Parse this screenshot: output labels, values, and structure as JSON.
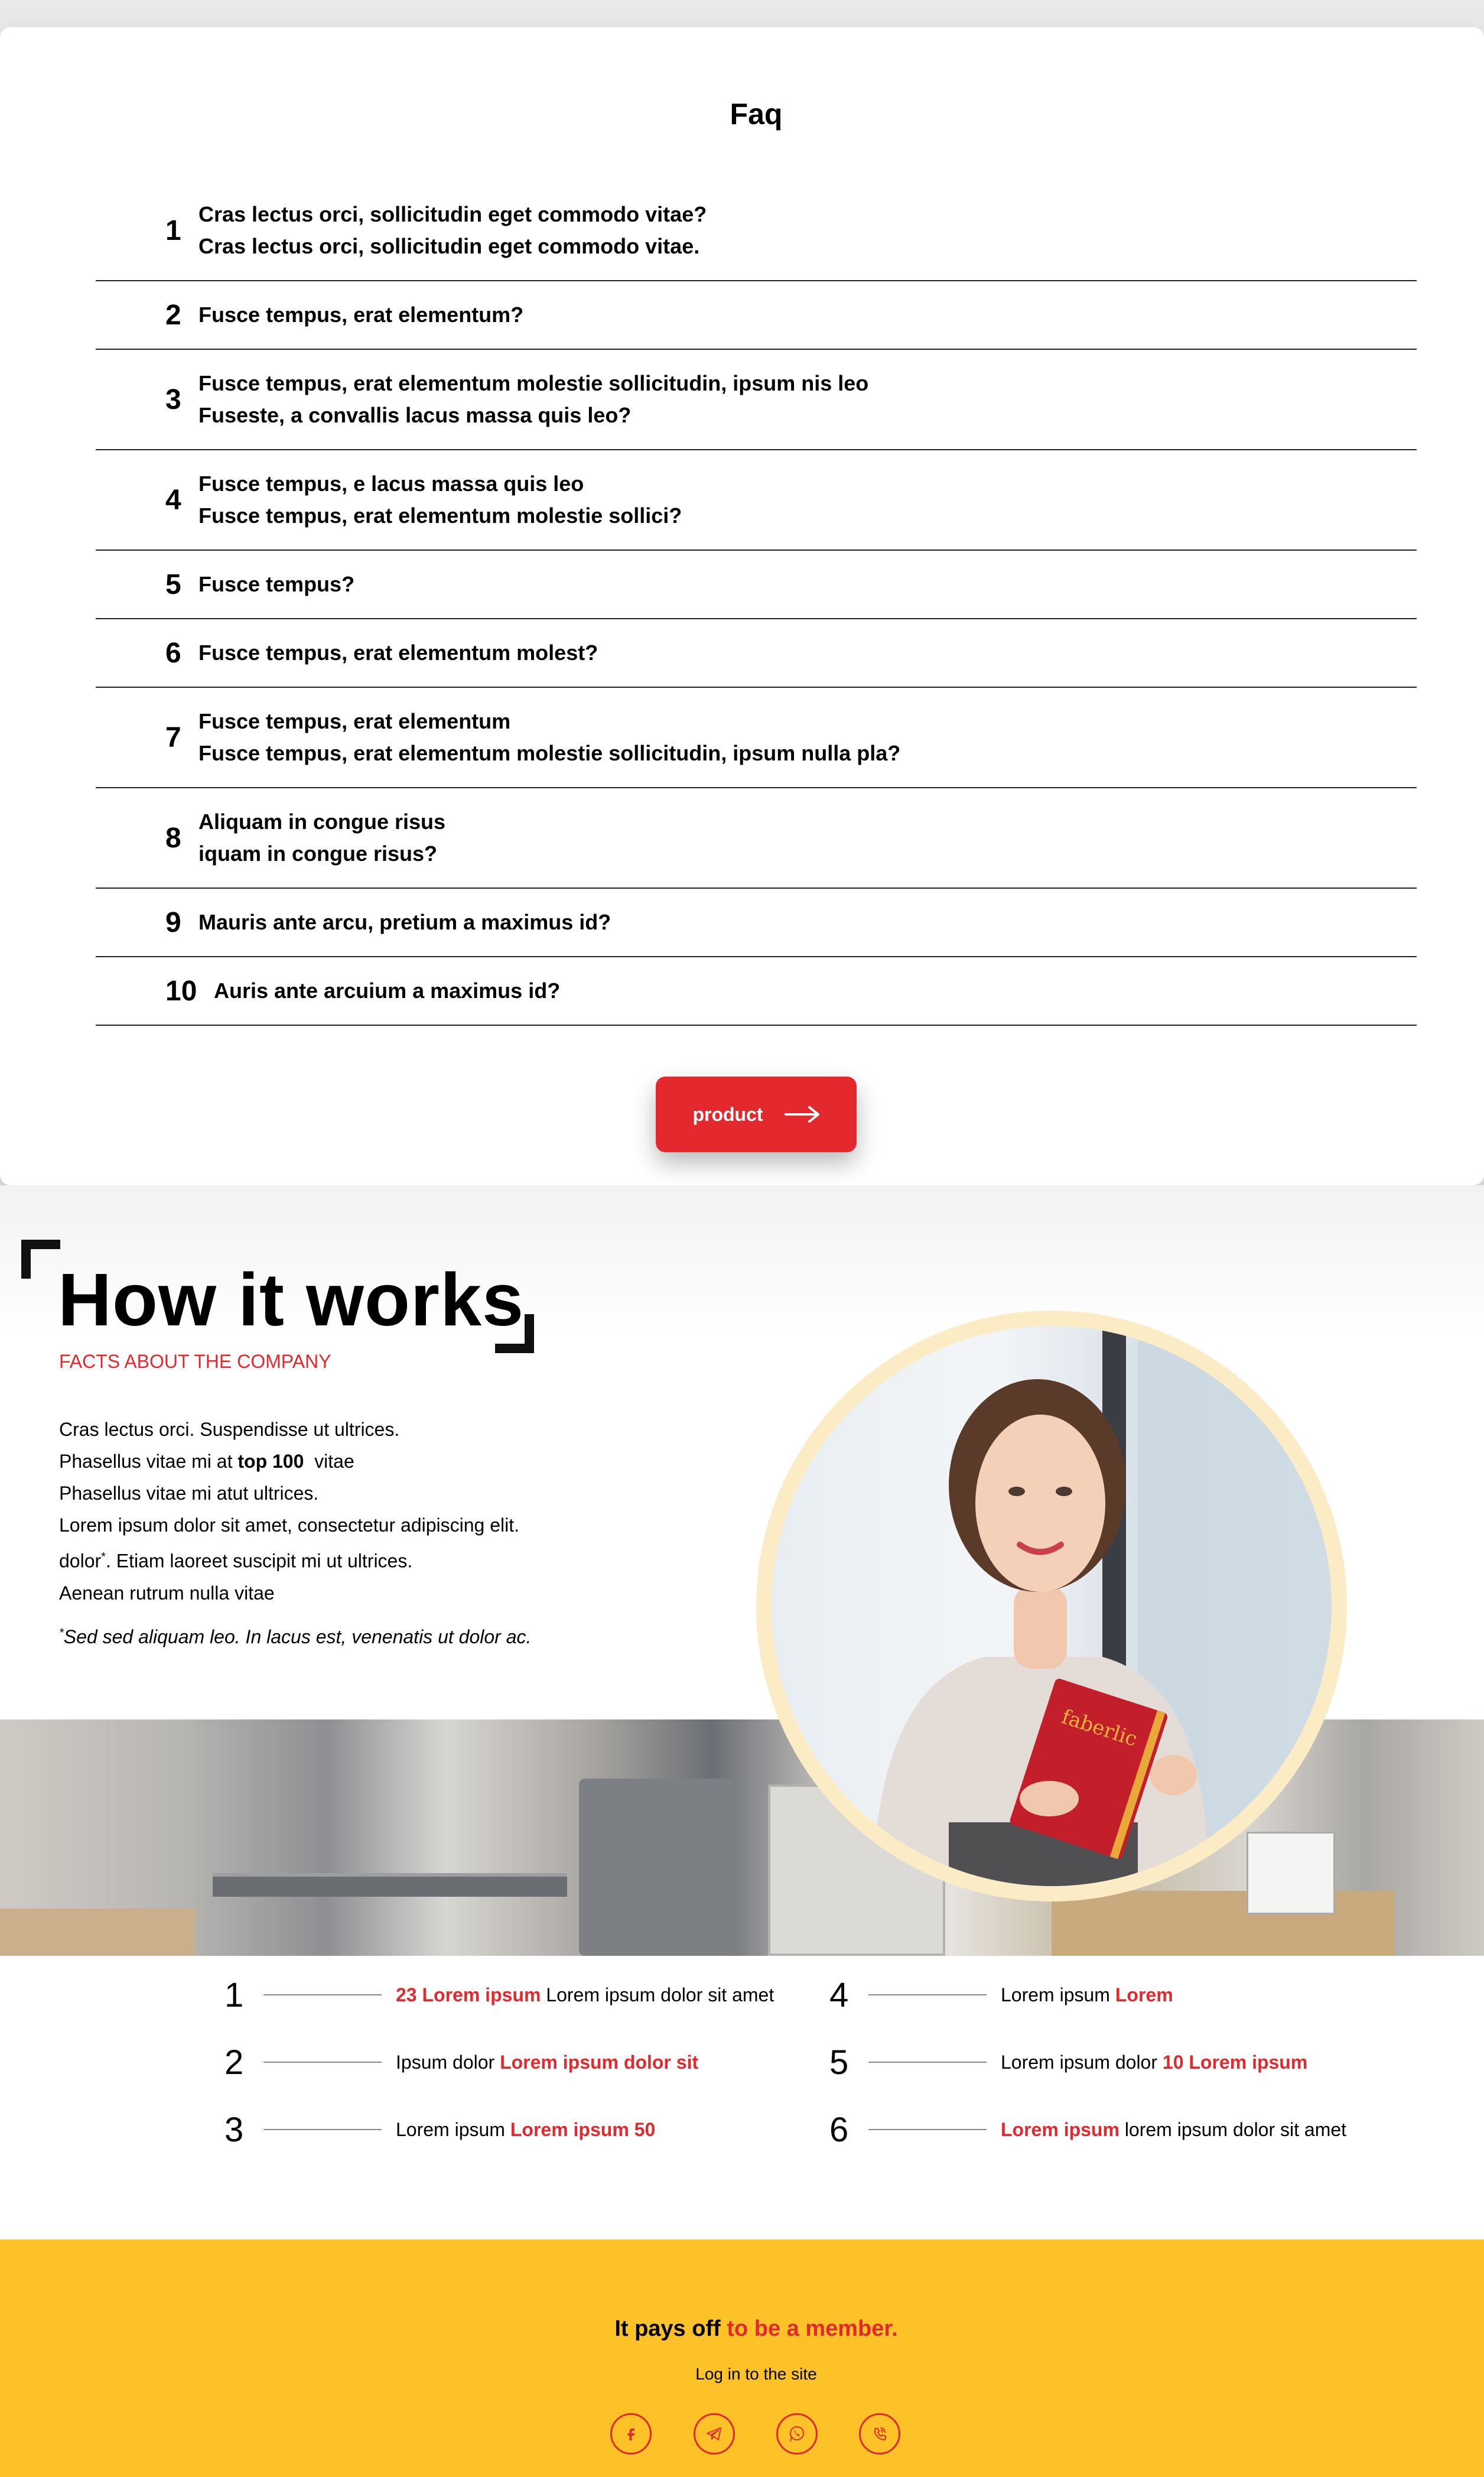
{
  "faq": {
    "title": "Faq",
    "items": [
      {
        "num": "1",
        "line1": "Cras lectus orci, sollicitudin eget commodo vitae?",
        "line2": "Cras lectus orci, sollicitudin eget commodo vitae."
      },
      {
        "num": "2",
        "line1": "Fusce tempus, erat elementum?"
      },
      {
        "num": "3",
        "line1": "Fusce tempus, erat elementum molestie sollicitudin, ipsum nis leo",
        "line2": "Fuseste, a convallis lacus massa quis leo?"
      },
      {
        "num": "4",
        "line1": "Fusce tempus, e lacus massa quis leo",
        "line2": "Fusce tempus, erat elementum molestie sollici?"
      },
      {
        "num": "5",
        "line1": "Fusce tempus?"
      },
      {
        "num": "6",
        "line1": "Fusce tempus, erat elementum molest?"
      },
      {
        "num": "7",
        "line1": "Fusce tempus, erat elementum",
        "line2": "Fusce tempus, erat elementum molestie sollicitudin, ipsum nulla pla?"
      },
      {
        "num": "8",
        "line1": "Aliquam in congue risus",
        "line2": "iquam in congue risus?"
      },
      {
        "num": "9",
        "line1": "Mauris ante arcu, pretium a maximus id?"
      },
      {
        "num": "10",
        "line1": "Auris ante arcuium a maximus id?"
      }
    ],
    "button_label": "product",
    "button_color": "#e3282e"
  },
  "how": {
    "title": "How it works",
    "subtitle": "FACTS ABOUT THE COMPANY",
    "body": {
      "l1": "Cras lectus orci. Suspendisse ut ultrices.",
      "l2_pre": "Phasellus vitae mi at ",
      "l2_bold": "top 100",
      "l2_post": "  vitae",
      "l3": "Phasellus vitae mi atut ultrices.",
      "l4": "Lorem ipsum dolor sit amet, consectetur adipiscing elit.",
      "l5_pre": "dolor",
      "l5_sup": "*",
      "l5_post": ". Etiam laoreet suscipit mi ut ultrices.",
      "l6": "Aenean rutrum nulla vitae"
    },
    "note_sup": "*",
    "note": "Sed sed aliquam leo. In lacus est, venenatis ut dolor ac.",
    "book_text": "faberlic"
  },
  "facts": [
    {
      "num": "1",
      "red": "23 Lorem ipsum",
      "text": " Lorem ipsum dolor sit amet",
      "red_first": true
    },
    {
      "num": "2",
      "text": "Ipsum dolor ",
      "red": "Lorem ipsum dolor sit",
      "red_first": false
    },
    {
      "num": "3",
      "text": "Lorem ipsum ",
      "red": "Lorem ipsum 50",
      "red_first": false
    },
    {
      "num": "4",
      "text": "Lorem ipsum ",
      "red": "Lorem",
      "red_first": false
    },
    {
      "num": "5",
      "text": "Lorem ipsum dolor ",
      "red": "10 Lorem ipsum",
      "red_first": false
    },
    {
      "num": "6",
      "red": "Lorem ipsum",
      "text": " lorem ipsum dolor sit amet",
      "red_first": true
    }
  ],
  "footer": {
    "title_black": "It pays off ",
    "title_red": "to be a member.",
    "login": "Log in to the site",
    "bg_color": "#fdc228",
    "social_icons": [
      "facebook-icon",
      "telegram-icon",
      "whatsapp-icon",
      "viber-icon"
    ]
  }
}
